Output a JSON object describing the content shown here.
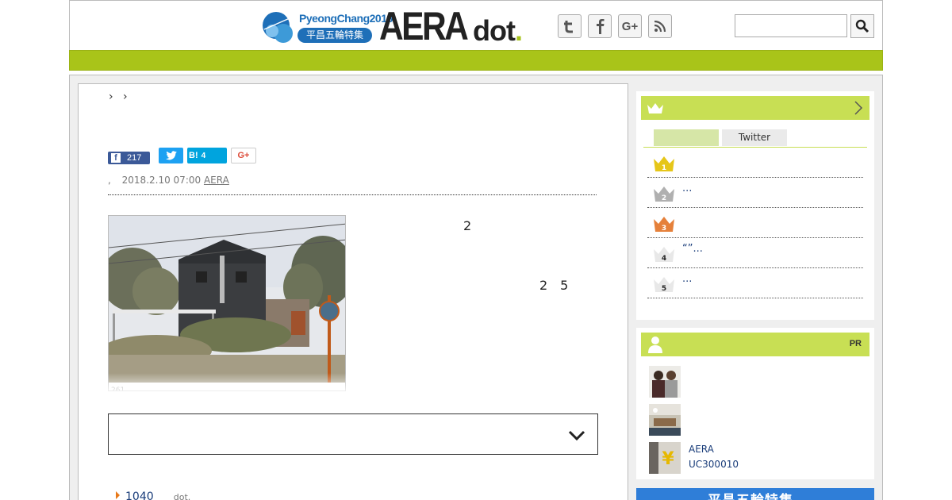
{
  "header": {
    "olympic_text": "PyeongChang2018",
    "olympic_badge": "平昌五輪特集",
    "brand_aera": "AERA",
    "brand_dot": "dot",
    "brand_dot_mark": ".",
    "social_icons": [
      "twitter-icon",
      "facebook-icon",
      "google-plus-icon",
      "rss-icon"
    ],
    "social_glyphs": [
      "t",
      "f",
      "G+",
      ""
    ],
    "search_placeholder": ""
  },
  "breadcrumb": {
    "separators": "› ›"
  },
  "share": {
    "facebook_letter": "f",
    "facebook_count": "217",
    "hatena_label": "B!",
    "hatena_count": "4",
    "gplus_label": "G+"
  },
  "meta": {
    "sep": ",",
    "date": "2018.2.10 07:00",
    "source": "AERA"
  },
  "photo": {
    "caption": "261"
  },
  "article": {
    "lines": [
      "　　　　　　　　2　　　　　　　　　　　　　　　　　　　　　",
      "　　　　　　　　　　　　　　　　　　　　　　　　　　　",
      "",
      "　　　　　　　　　　　　　　2　5　　　　　　　　　　　　　　　",
      "　　　　　　　　　　　　　　　　　　　　　　　　　　　　　　　",
      "　　　　　　　　　　　　　　　　　　　　　　　　　　　　　　　",
      "　　　　　　　　　　　　　　　　　　　　　　　　　　　",
      "",
      "　　　　　　　　　　　　　　　　　　　　　　　　　　　　　　　"
    ]
  },
  "related": {
    "count": "1040",
    "source": "dot."
  },
  "ranking": {
    "tabs": [
      "",
      "Twitter"
    ],
    "items": [
      {
        "rank": "1",
        "text": "",
        "color": "#e6c619"
      },
      {
        "rank": "2",
        "text": "...",
        "color": "#b0b0b0"
      },
      {
        "rank": "3",
        "text": "",
        "color": "#e5803a"
      },
      {
        "rank": "4",
        "text": "“”...",
        "color": "#e8e8e8"
      },
      {
        "rank": "5",
        "text": "...",
        "color": "#e8e8e8"
      }
    ]
  },
  "pr": {
    "label": "PR",
    "items": [
      {
        "line1": "",
        "line2": ""
      },
      {
        "line1": "",
        "line2": ""
      },
      {
        "line1": "AERA",
        "line2": "UC300010"
      }
    ]
  },
  "banner": {
    "text": "平昌五輪特集"
  },
  "colors": {
    "brand_green": "#a9c419",
    "panel_green": "#c8df54",
    "link_blue": "#1a3d7a",
    "olympic_blue": "#1e6fb8"
  }
}
